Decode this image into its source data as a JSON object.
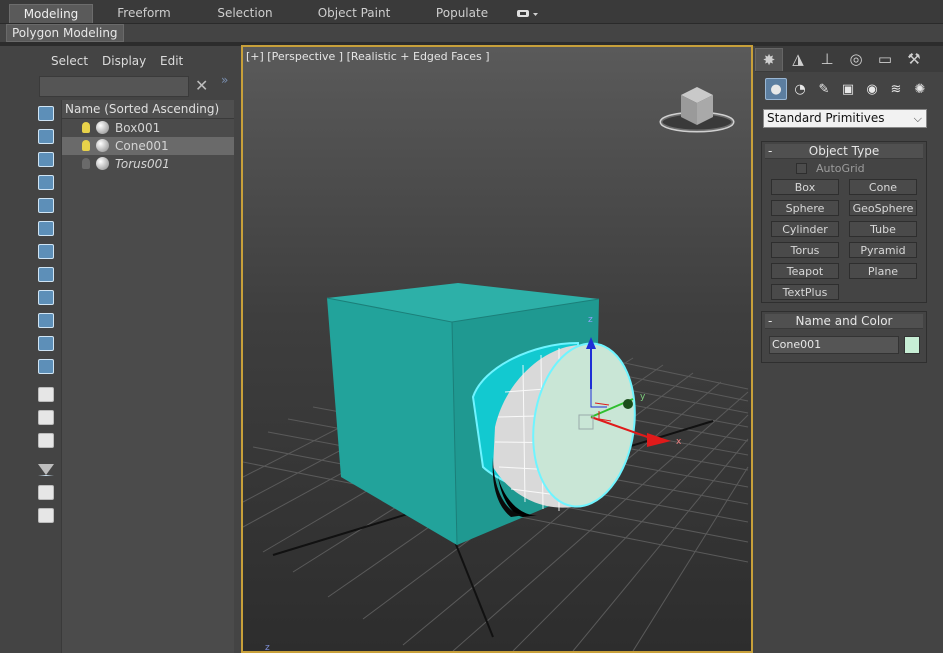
{
  "ribbon": {
    "tabs": [
      "Modeling",
      "Freeform",
      "Selection",
      "Object Paint",
      "Populate"
    ],
    "active_tab": "Modeling",
    "subtab": "Polygon Modeling"
  },
  "scene_explorer": {
    "menu": [
      "Select",
      "Display",
      "Edit"
    ],
    "column_header": "Name (Sorted Ascending)",
    "items": [
      {
        "name": "Box001",
        "light_on": true,
        "selected": false,
        "frozen": false
      },
      {
        "name": "Cone001",
        "light_on": true,
        "selected": true,
        "frozen": false
      },
      {
        "name": "Torus001",
        "light_on": false,
        "selected": false,
        "frozen": true
      }
    ]
  },
  "viewport": {
    "label": "[+] [Perspective ] [Realistic + Edged Faces ]",
    "gizmo_axes": {
      "x": "x",
      "y": "y",
      "z": "z"
    },
    "corner_axis": "z",
    "colors": {
      "box": "#26a39c",
      "cone": "#c9e6d6",
      "selection": "#6ff4ff",
      "border_active": "#c8a03a"
    }
  },
  "command_panel": {
    "tabs": [
      "create-icon",
      "modify-icon",
      "hierarchy-icon",
      "motion-icon",
      "display-icon",
      "utilities-icon"
    ],
    "categories": [
      "geometry-icon",
      "shapes-icon",
      "lights-icon",
      "cameras-icon",
      "helpers-icon",
      "spacewarps-icon",
      "systems-icon"
    ],
    "dropdown": "Standard Primitives",
    "object_type": {
      "title": "Object Type",
      "autogrid": "AutoGrid",
      "buttons": [
        "Box",
        "Cone",
        "Sphere",
        "GeoSphere",
        "Cylinder",
        "Tube",
        "Torus",
        "Pyramid",
        "Teapot",
        "Plane",
        "TextPlus"
      ]
    },
    "name_and_color": {
      "title": "Name and Color",
      "name": "Cone001",
      "color": "#c7eed5"
    }
  }
}
